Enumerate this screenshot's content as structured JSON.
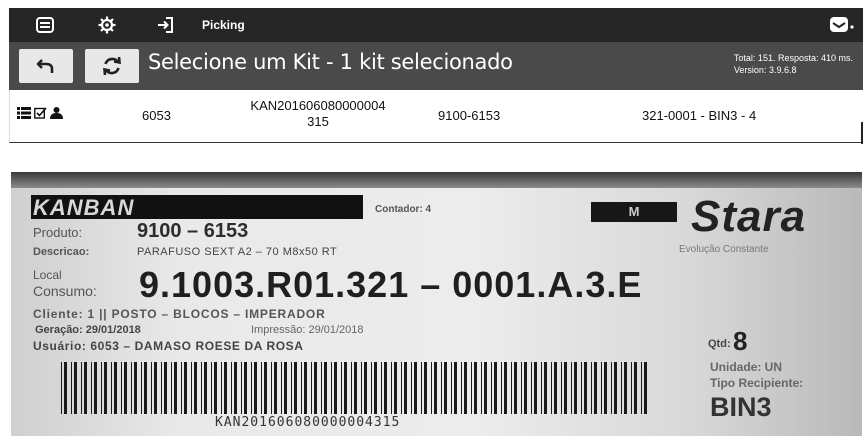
{
  "topbar": {
    "menu_icon": "list-icon",
    "settings_icon": "gear-icon",
    "login_icon": "sign-in-icon",
    "title": "Picking",
    "mail_icon": "envelope-icon"
  },
  "toolbar": {
    "back_icon": "undo-icon",
    "refresh_icon": "refresh-icon",
    "headline": "Selecione um Kit - 1 kit selecionado",
    "stats_line1": "Total: 151. Resposta: 410 ms.",
    "stats_line2": "Version: 3.9.6.8"
  },
  "kit_row": {
    "icons": [
      "list-icon",
      "checkbox-icon",
      "user-icon"
    ],
    "code": "6053",
    "kanban_line1": "KAN201606080000004",
    "kanban_line2": "315",
    "product": "9100-6153",
    "location": "321-0001 - BIN3 - 4"
  },
  "label_photo": {
    "kanban": "KANBAN",
    "contador": "Contador: 4",
    "grade": "M",
    "brand": "Stara",
    "brand_slogan": "Evolução Constante",
    "produto_label": "Produto:",
    "produto": "9100 – 6153",
    "descricao_label": "Descricao:",
    "descricao": "PARAFUSO SEXT A2 – 70  M8x50 RT",
    "local_label_1": "Local",
    "local_label_2": "Consumo:",
    "local": "9.1003.R01.321 – 0001.A.3.E",
    "cliente": "Cliente:  1 || POSTO – BLOCOS – IMPERADOR",
    "geracao": "Geração:  29/01/2018",
    "impressao": "Impressão:  29/01/2018",
    "usuario": "Usuário:  6053 – DAMASO ROESE DA ROSA",
    "qtd_label": "Qtd:",
    "qtd": "8",
    "unidade": "Unidade: UN",
    "tipo_label": "Tipo Recipiente:",
    "tipo": "BIN3",
    "barcode_text": "KAN201606080000004315"
  }
}
